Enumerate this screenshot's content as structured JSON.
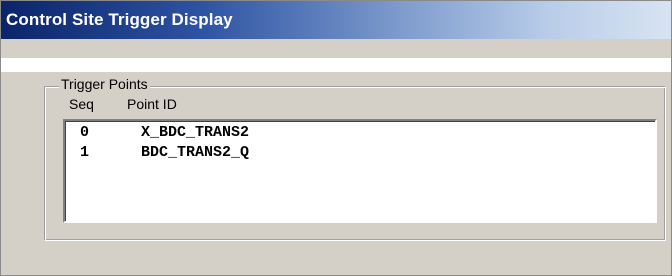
{
  "window": {
    "title": "Control Site Trigger Display"
  },
  "trigger_points": {
    "group_label": "Trigger Points",
    "columns": {
      "seq": "Seq",
      "point_id": "Point ID"
    },
    "rows": [
      {
        "seq": "0",
        "point_id": "X_BDC_TRANS2"
      },
      {
        "seq": "1",
        "point_id": "BDC_TRANS2_Q"
      }
    ]
  },
  "colors": {
    "title_bar_start": "#0a246a",
    "title_bar_end": "#d8e3f2",
    "panel_background": "#d4d0c8",
    "list_background": "#ffffff"
  }
}
